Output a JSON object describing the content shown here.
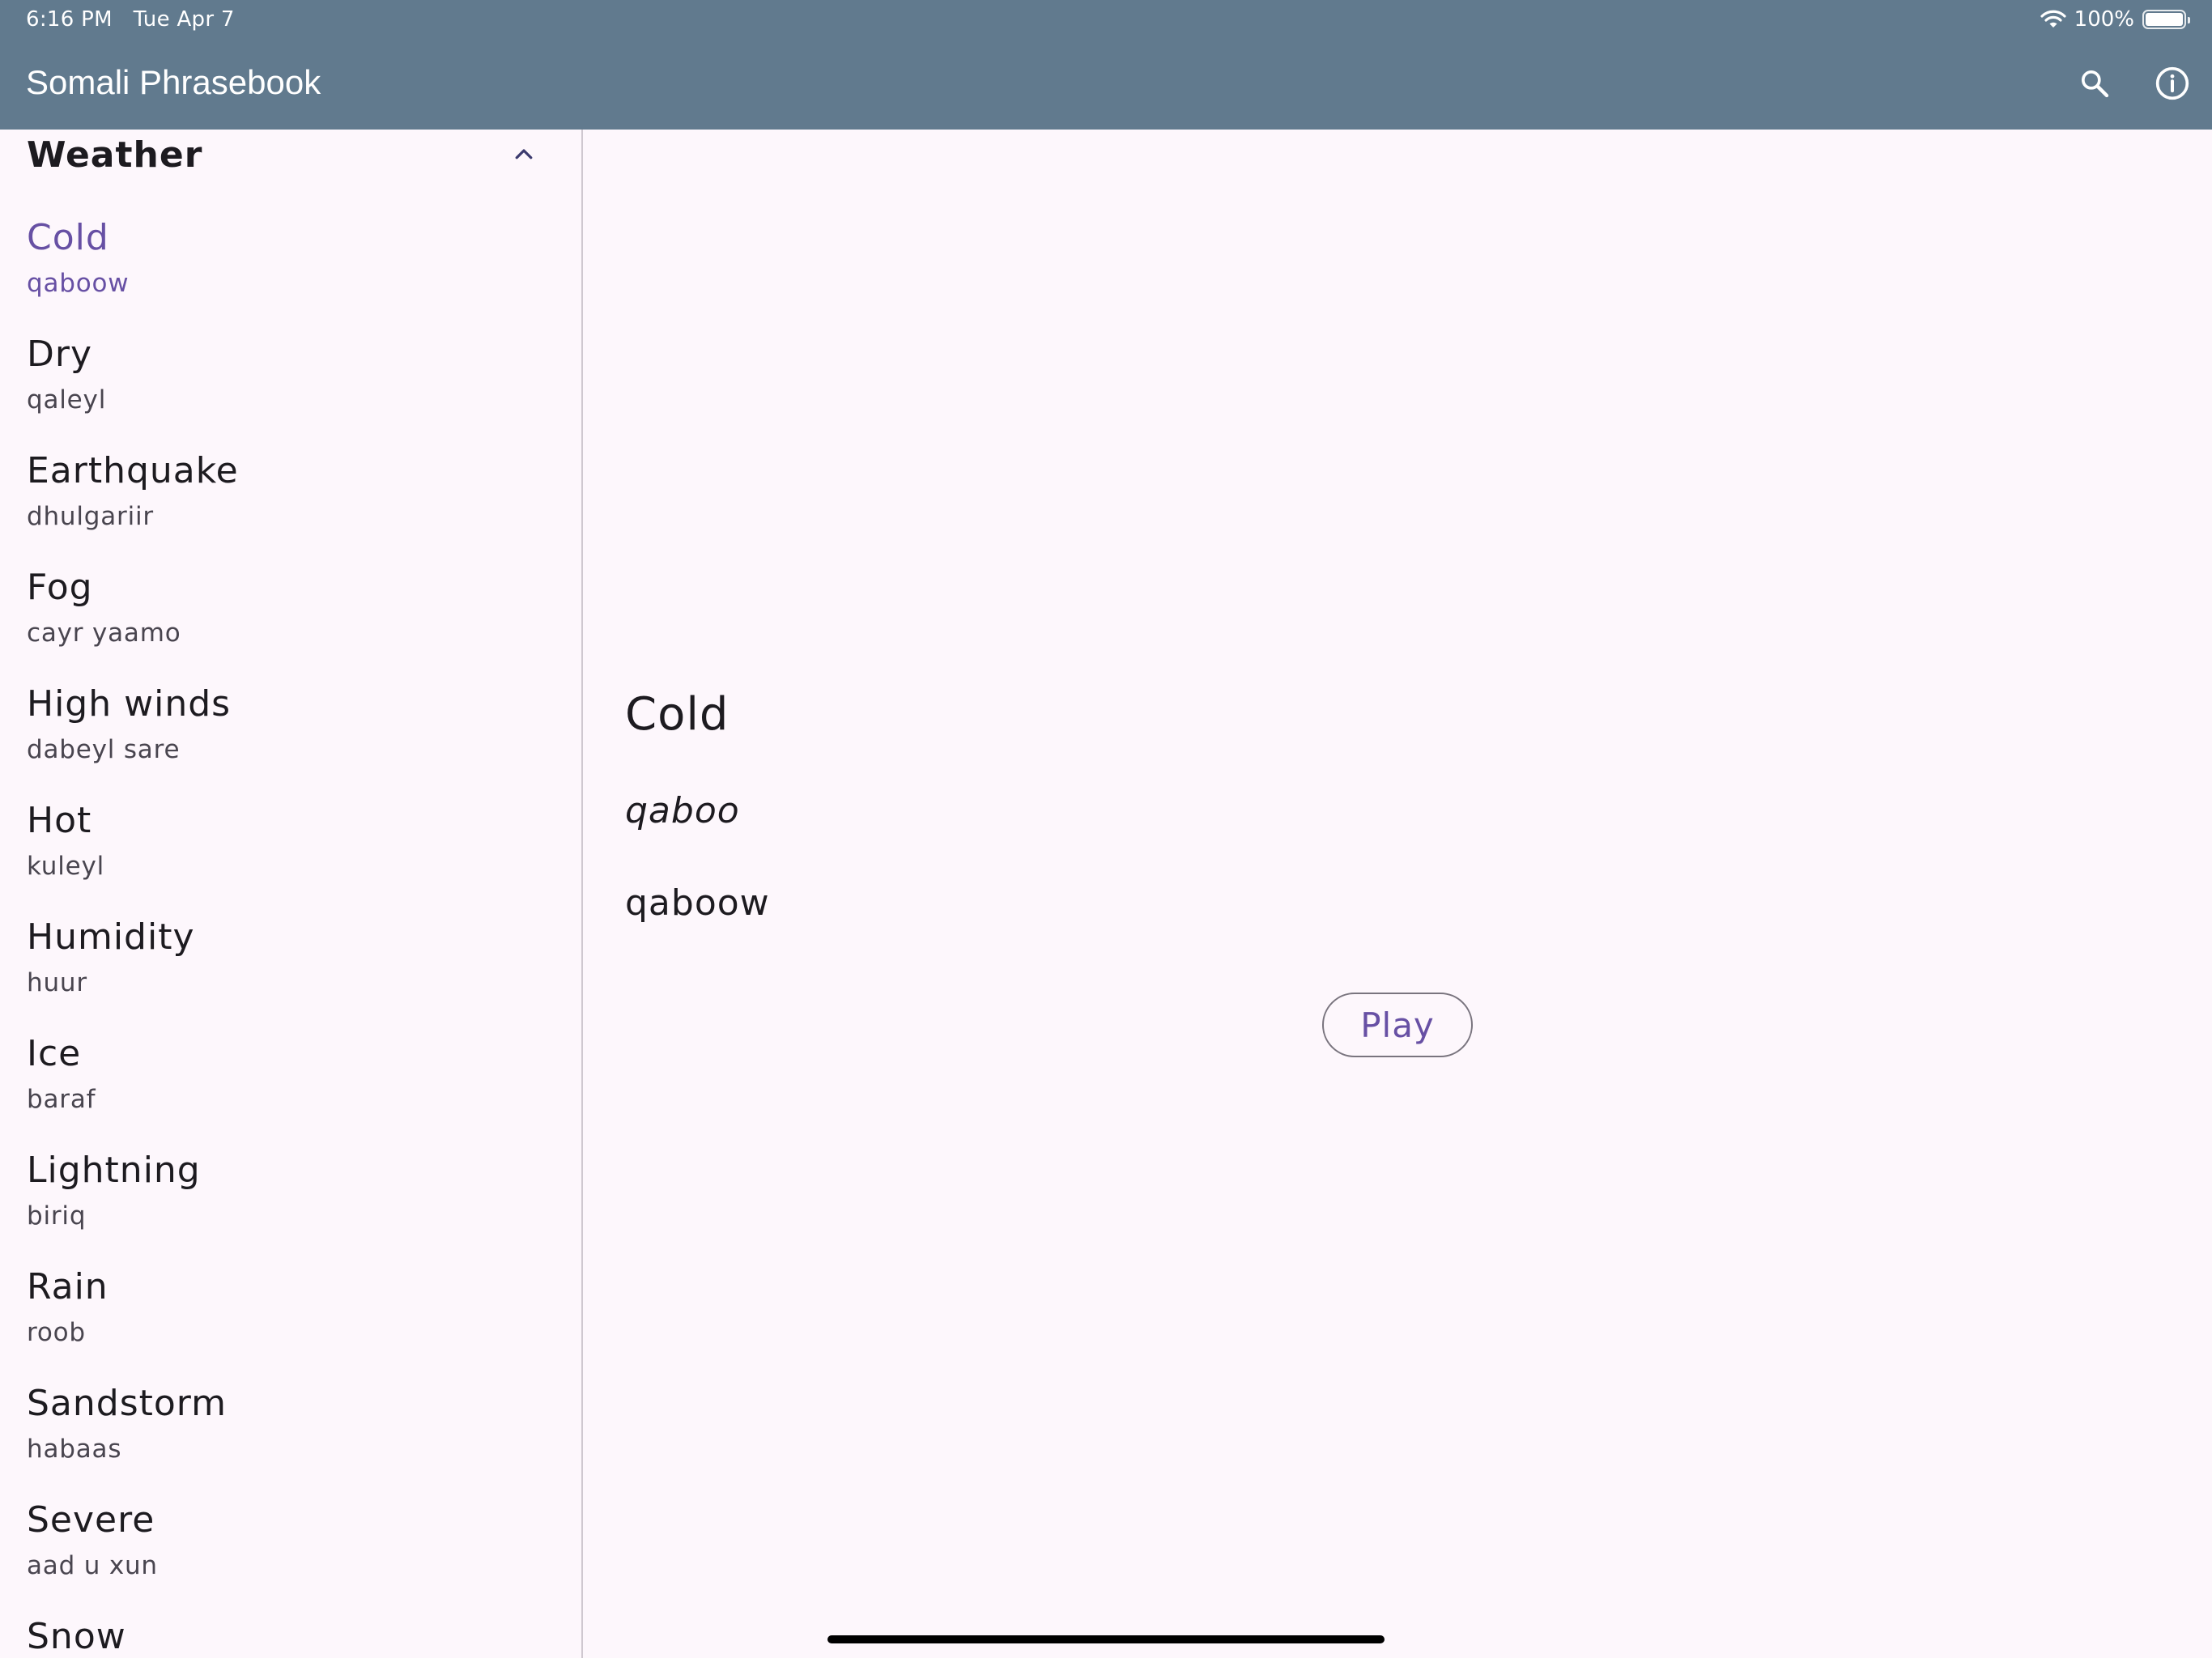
{
  "status_bar": {
    "time": "6:16 PM",
    "date": "Tue Apr 7",
    "battery": "100%",
    "battery_level": 1.0,
    "icons": [
      "wifi-icon",
      "battery-icon"
    ]
  },
  "app_bar": {
    "title": "Somali Phrasebook",
    "background": "#617a8e",
    "actions": [
      {
        "icon": "search-icon"
      },
      {
        "icon": "info-icon"
      }
    ]
  },
  "sidebar": {
    "section_title": "Weather",
    "expanded": true,
    "selected_index": 0,
    "items": [
      {
        "english": "Cold",
        "somali": "qaboow"
      },
      {
        "english": "Dry",
        "somali": "qaleyl"
      },
      {
        "english": "Earthquake",
        "somali": "dhulgariir"
      },
      {
        "english": "Fog",
        "somali": "cayr yaamo"
      },
      {
        "english": "High winds",
        "somali": "dabeyl sare"
      },
      {
        "english": "Hot",
        "somali": "kuleyl"
      },
      {
        "english": "Humidity",
        "somali": "huur"
      },
      {
        "english": "Ice",
        "somali": "baraf"
      },
      {
        "english": "Lightning",
        "somali": "biriq"
      },
      {
        "english": "Rain",
        "somali": "roob"
      },
      {
        "english": "Sandstorm",
        "somali": "habaas"
      },
      {
        "english": "Severe",
        "somali": "aad u xun"
      },
      {
        "english": "Snow",
        "somali": ""
      }
    ]
  },
  "detail": {
    "english": "Cold",
    "pronunciation": "qaboo",
    "somali": "qaboow",
    "play_label": "Play"
  },
  "colors": {
    "accent": "#6750a4",
    "background": "#fdf7fc",
    "text": "#1d1b20",
    "secondary_text": "#49454f"
  }
}
